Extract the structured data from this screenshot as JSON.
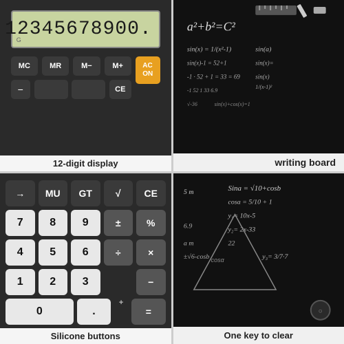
{
  "cells": {
    "top_left": {
      "display_value": "12345678900.",
      "g_label": "G",
      "buttons_row1": [
        "MC",
        "MR",
        "M−",
        "M+"
      ],
      "ac_label": "AC\nON",
      "bottom_row": [
        "−",
        "",
        "",
        "CE"
      ],
      "label": "12-digit display"
    },
    "top_right": {
      "label": "writing board",
      "formula1": "a² + b² = C²",
      "formula2": "sin(x) = ...",
      "formula3": "a = sin(x)"
    },
    "bottom_left": {
      "label": "Silicone buttons",
      "row1": [
        "→",
        "MU",
        "GT",
        "√",
        "CE"
      ],
      "row2": [
        "7",
        "8",
        "9",
        "±",
        "%"
      ],
      "row3": [
        "4",
        "5",
        "6",
        "÷",
        "×"
      ],
      "row4": [
        "1",
        "2",
        "3",
        "",
        "−"
      ],
      "row5_zero": "0",
      "row5_dot": ".",
      "row5_eq": "=",
      "plus_label": "+"
    },
    "bottom_right": {
      "label": "One key to clear",
      "math_lines": [
        "Sina = √10+cosb",
        "cosa = 5/10 + 1",
        "y₁= 10x-5",
        "6.9   y₂= 2x-33",
        "a    m      22",
        "± √6-cosb  y₃= 3/7 · 7"
      ]
    }
  },
  "icons": {
    "ruler": "📐",
    "pencil": "✏️",
    "eraser": "⬜"
  }
}
